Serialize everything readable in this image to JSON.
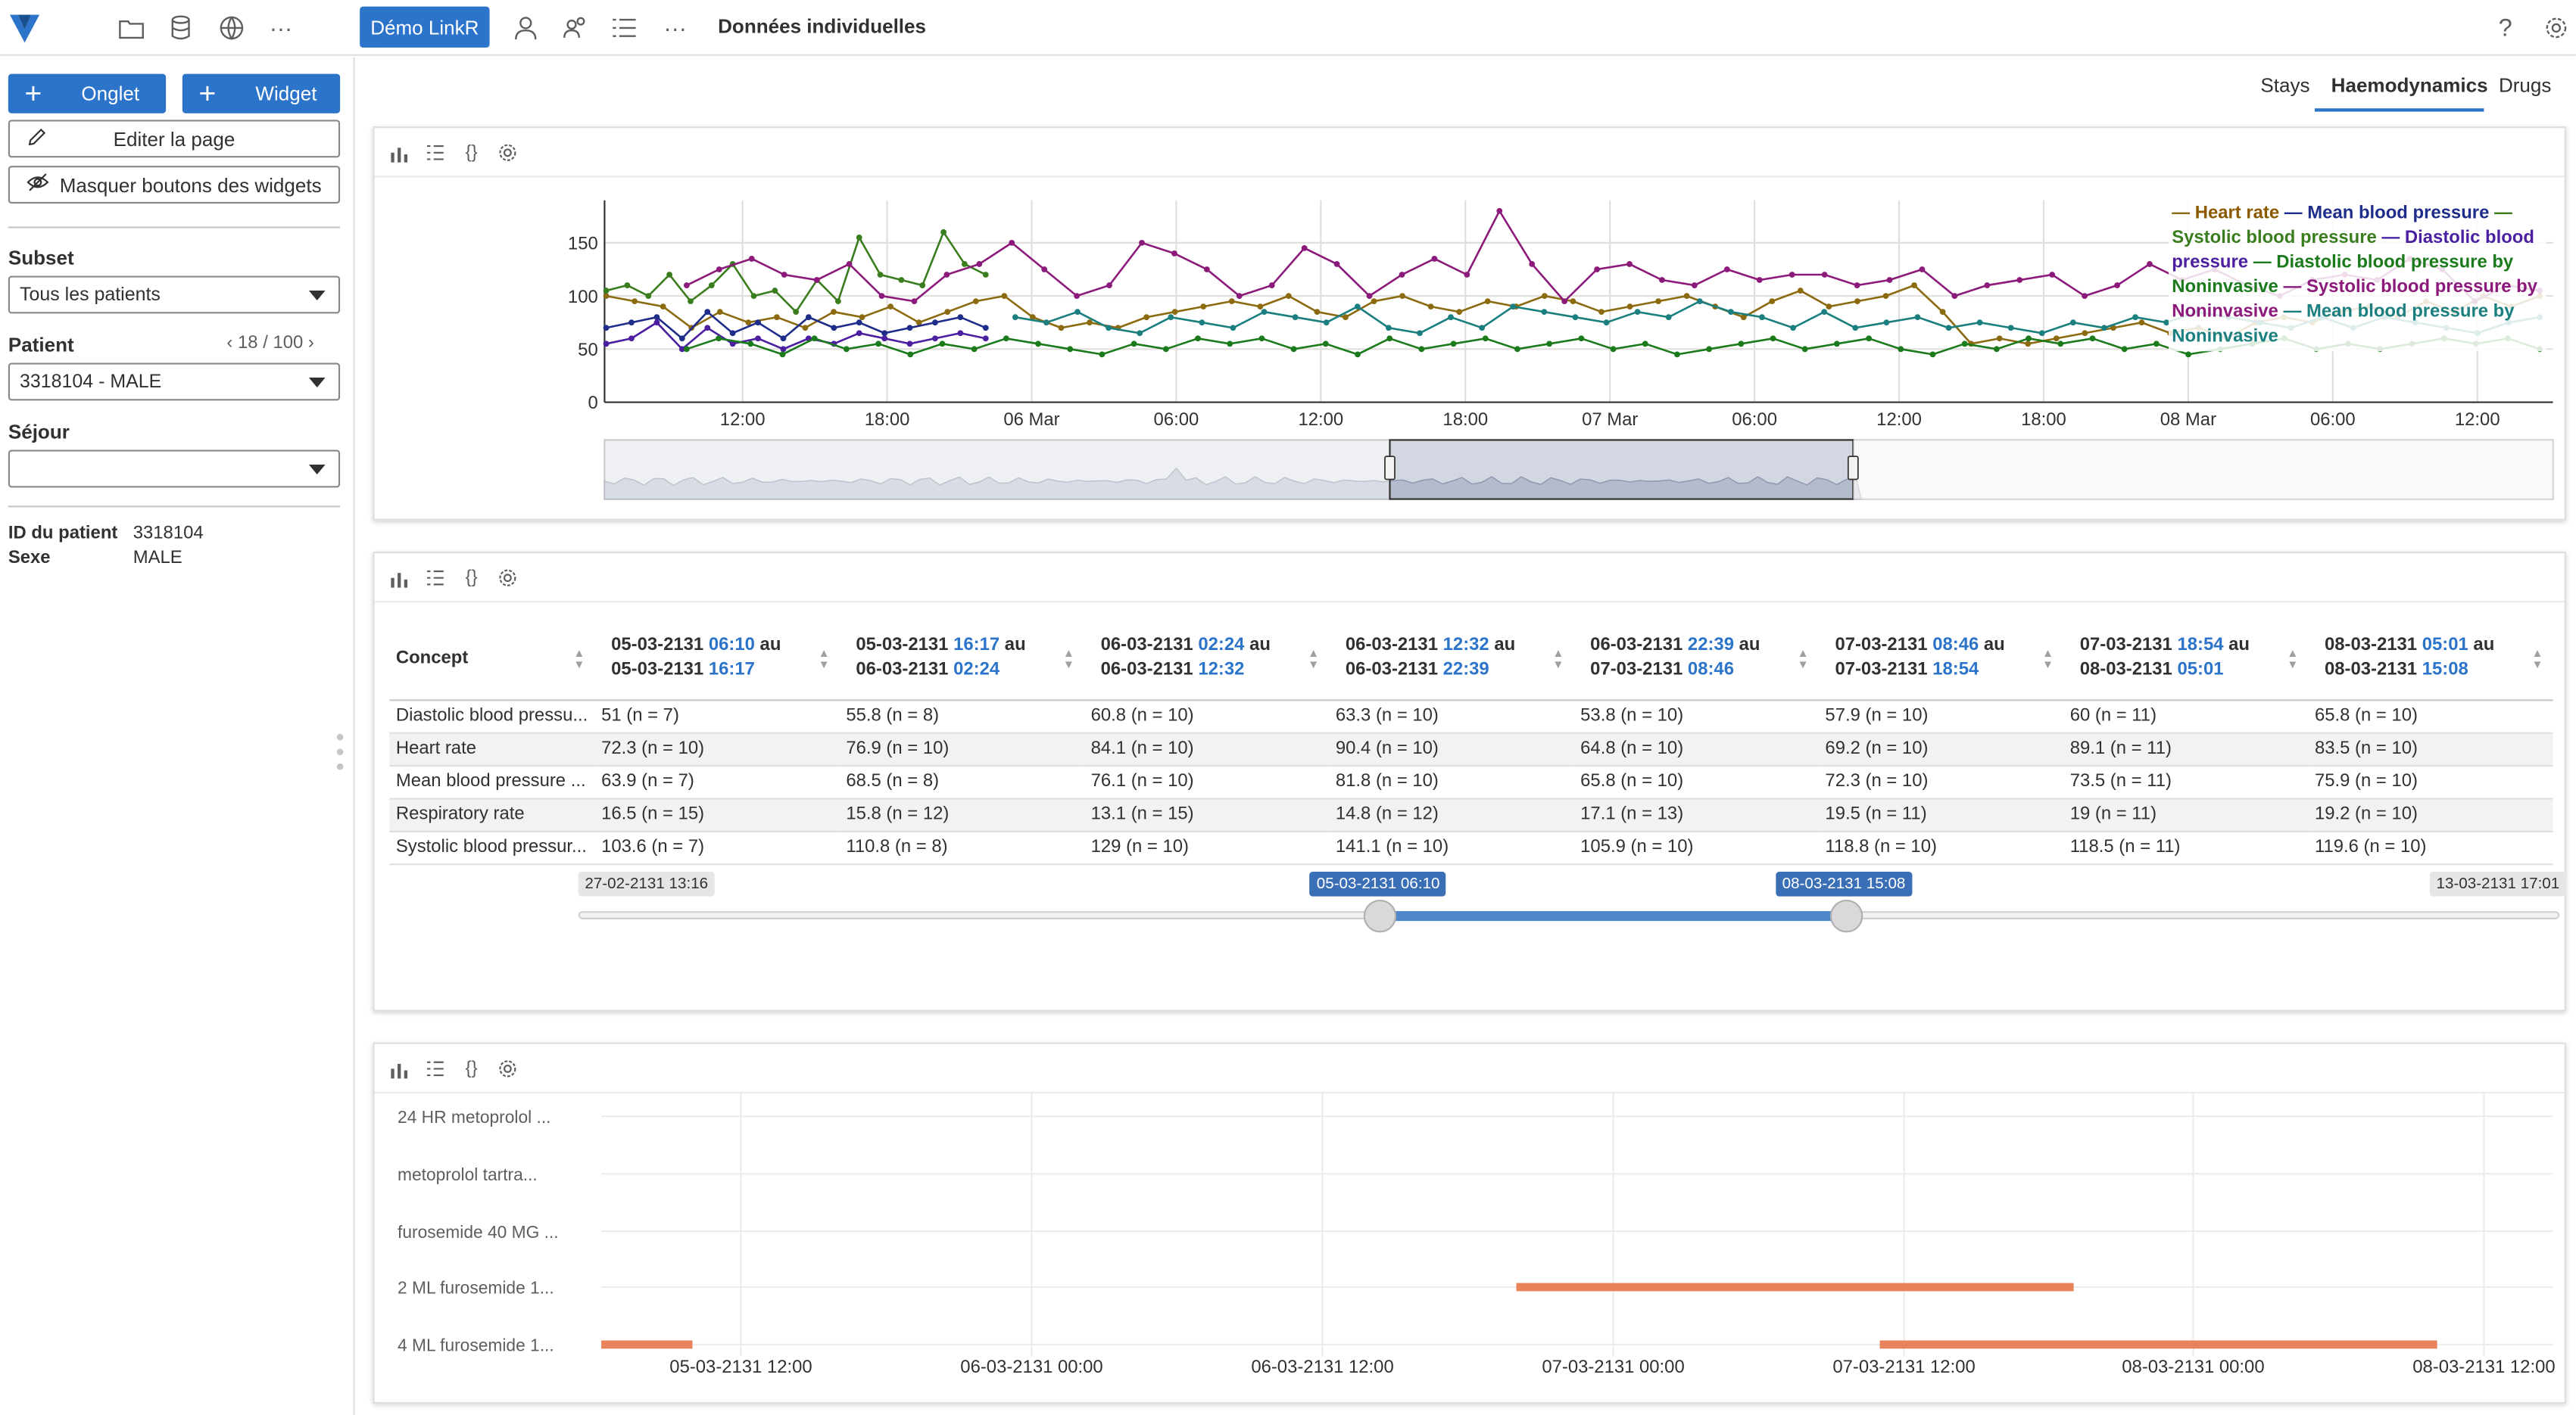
{
  "topbar": {
    "demo_button": "Démo LinkR",
    "more": "···",
    "page_title": "Données individuelles",
    "help": "?"
  },
  "sidebar": {
    "onglet_button": "Onglet",
    "widget_button": "Widget",
    "edit_page_button": "Editer la page",
    "hide_buttons": "Masquer boutons des widgets",
    "subset_label": "Subset",
    "subset_value": "Tous les patients",
    "patient_label": "Patient",
    "patient_pager": "18 / 100",
    "patient_value": "3318104 - MALE",
    "sejour_label": "Séjour",
    "sejour_value": "",
    "id_label": "ID du patient",
    "id_value": "3318104",
    "sex_label": "Sexe",
    "sex_value": "MALE"
  },
  "tabs": [
    "Stays",
    "Haemodynamics",
    "Drugs"
  ],
  "active_tab": "Haemodynamics",
  "chart_data": [
    {
      "type": "line",
      "y_ticks": [
        "0",
        "50",
        "100",
        "150"
      ],
      "ylim": [
        0,
        190
      ],
      "x_ticks": [
        "12:00",
        "18:00",
        "06 Mar",
        "06:00",
        "12:00",
        "18:00",
        "07 Mar",
        "06:00",
        "12:00",
        "18:00",
        "08 Mar",
        "06:00",
        "12:00"
      ],
      "legend_placement": "top-right",
      "legend_text": [
        {
          "text": "Heart rate",
          "color": "#8b5a00"
        },
        {
          "text": " — ",
          "color": "#1f2d8a"
        },
        {
          "text": "Mean blood pressure",
          "color": "#1f2d8a"
        },
        {
          "text": " — ",
          "color": "#3a7d1e"
        },
        {
          "text": "Systolic blood pressure",
          "color": "#3a7d1e"
        },
        {
          "text": " — ",
          "color": "#4b1fa0"
        },
        {
          "text": "Diastolic blood pressure",
          "color": "#4b1fa0"
        },
        {
          "text": " — ",
          "color": "#1b7a1b"
        },
        {
          "text": "Diastolic blood pressure by Noninvasive",
          "color": "#1b7a1b"
        },
        {
          "text": " — ",
          "color": "#8b1a7a"
        },
        {
          "text": "Systolic blood pressure by Noninvasive",
          "color": "#8b1a7a"
        },
        {
          "text": " — ",
          "color": "#1b7f7f"
        },
        {
          "text": "Mean blood pressure by Noninvasive",
          "color": "#1b7f7f"
        }
      ],
      "series": [
        {
          "name": "Heart rate",
          "color": "#8b6a10",
          "values": [
            100,
            95,
            90,
            70,
            85,
            75,
            80,
            70,
            85,
            80,
            90,
            75,
            85,
            95,
            100,
            80,
            70,
            75,
            70,
            80,
            85,
            90,
            95,
            90,
            100,
            85,
            80,
            95,
            100,
            90,
            85,
            95,
            90,
            100,
            95,
            85,
            90,
            95,
            100,
            90,
            80,
            95,
            105,
            90,
            95,
            100,
            110,
            85,
            55,
            60,
            55,
            60,
            65,
            70,
            75,
            65,
            70,
            60,
            75,
            80,
            75,
            85,
            90,
            80,
            95,
            85,
            100,
            90,
            100
          ]
        },
        {
          "name": "Mean blood pressure",
          "color": "#1f2d8a",
          "values": [
            70,
            75,
            80,
            60,
            85,
            65,
            75,
            60,
            80,
            70,
            75,
            65,
            70,
            75,
            80,
            70
          ]
        },
        {
          "name": "Systolic blood pressure",
          "color": "#3a7d1e",
          "values": [
            105,
            110,
            100,
            120,
            95,
            110,
            130,
            100,
            105,
            85,
            115,
            95,
            155,
            120,
            115,
            110,
            160,
            130,
            120
          ]
        },
        {
          "name": "Diastolic blood pressure",
          "color": "#4b1fa0",
          "values": [
            55,
            60,
            75,
            50,
            70,
            55,
            60,
            50,
            60,
            55,
            65,
            60,
            55,
            60,
            65,
            60
          ]
        },
        {
          "name": "Diastolic blood pressure by Noninvasive",
          "color": "#1b7a1b",
          "values": [
            50,
            60,
            55,
            45,
            60,
            50,
            55,
            45,
            55,
            50,
            60,
            55,
            50,
            45,
            55,
            50,
            60,
            55,
            60,
            50,
            55,
            45,
            60,
            50,
            55,
            60,
            50,
            55,
            60,
            50,
            55,
            45,
            50,
            55,
            60,
            50,
            55,
            60,
            50,
            45,
            55,
            50,
            60,
            55,
            60,
            50,
            55,
            45,
            50,
            55,
            60,
            50,
            55,
            50,
            55,
            60,
            55,
            60,
            50
          ]
        },
        {
          "name": "Systolic blood pressure by Noninvasive",
          "color": "#8b1a7a",
          "values": [
            110,
            125,
            135,
            120,
            115,
            130,
            100,
            95,
            120,
            130,
            150,
            125,
            100,
            110,
            150,
            140,
            125,
            100,
            110,
            145,
            130,
            100,
            120,
            135,
            120,
            180,
            130,
            95,
            125,
            130,
            115,
            110,
            125,
            115,
            120,
            120,
            110,
            115,
            125,
            100,
            110,
            115,
            120,
            100,
            110,
            130,
            115,
            125,
            110,
            100,
            115,
            120,
            115,
            135,
            125,
            95,
            110,
            105
          ]
        },
        {
          "name": "Mean blood pressure by Noninvasive",
          "color": "#1b7f7f",
          "values": [
            80,
            75,
            85,
            70,
            65,
            80,
            75,
            70,
            85,
            80,
            75,
            90,
            70,
            65,
            80,
            70,
            90,
            85,
            80,
            75,
            85,
            80,
            95,
            85,
            80,
            70,
            85,
            70,
            75,
            80,
            70,
            75,
            70,
            65,
            75,
            70,
            80,
            75,
            85,
            80,
            75,
            70,
            80,
            70,
            80,
            75,
            70,
            65,
            75,
            80
          ]
        }
      ],
      "navigator_x_labels": []
    },
    {
      "type": "bar",
      "orientation": "horizontal",
      "categories": [
        "24 HR metoprolol ...",
        "metoprolol tartra...",
        "furosemide 40 MG ...",
        "2 ML furosemide 1...",
        "4 ML furosemide 1..."
      ],
      "x_ticks": [
        "05-03-2131 12:00",
        "06-03-2131 00:00",
        "06-03-2131 12:00",
        "07-03-2131 00:00",
        "07-03-2131 12:00",
        "08-03-2131 00:00",
        "08-03-2131 12:00"
      ],
      "x_range": [
        "05-03-2131 06:10",
        "08-03-2131 15:08"
      ],
      "bar_color": "#e8825a",
      "bars": [
        {
          "category": "2 ML furosemide 1...",
          "start": "06-03-2131 20:00",
          "end": "07-03-2131 19:00"
        },
        {
          "category": "4 ML furosemide 1...",
          "start": "05-03-2131 06:10",
          "end": "05-03-2131 10:00"
        },
        {
          "category": "4 ML furosemide 1...",
          "start": "07-03-2131 11:00",
          "end": "08-03-2131 10:00"
        }
      ]
    }
  ],
  "datatable": {
    "concept_header": "Concept",
    "columns": [
      {
        "d1": "05-03-2131",
        "t1": "06:10",
        "d2": "05-03-2131",
        "t2": "16:17"
      },
      {
        "d1": "05-03-2131",
        "t1": "16:17",
        "d2": "06-03-2131",
        "t2": "02:24"
      },
      {
        "d1": "06-03-2131",
        "t1": "02:24",
        "d2": "06-03-2131",
        "t2": "12:32"
      },
      {
        "d1": "06-03-2131",
        "t1": "12:32",
        "d2": "06-03-2131",
        "t2": "22:39"
      },
      {
        "d1": "06-03-2131",
        "t1": "22:39",
        "d2": "07-03-2131",
        "t2": "08:46"
      },
      {
        "d1": "07-03-2131",
        "t1": "08:46",
        "d2": "07-03-2131",
        "t2": "18:54"
      },
      {
        "d1": "07-03-2131",
        "t1": "18:54",
        "d2": "08-03-2131",
        "t2": "05:01"
      },
      {
        "d1": "08-03-2131",
        "t1": "05:01",
        "d2": "08-03-2131",
        "t2": "15:08"
      }
    ],
    "au": "au",
    "rows": [
      {
        "concept": "Diastolic blood pressu...",
        "values": [
          "51 (n = 7)",
          "55.8 (n = 8)",
          "60.8 (n = 10)",
          "63.3 (n = 10)",
          "53.8 (n = 10)",
          "57.9 (n = 10)",
          "60 (n = 11)",
          "65.8 (n = 10)"
        ]
      },
      {
        "concept": "Heart rate",
        "values": [
          "72.3 (n = 10)",
          "76.9 (n = 10)",
          "84.1 (n = 10)",
          "90.4 (n = 10)",
          "64.8 (n = 10)",
          "69.2 (n = 10)",
          "89.1 (n = 11)",
          "83.5 (n = 10)"
        ]
      },
      {
        "concept": "Mean blood pressure ...",
        "values": [
          "63.9 (n = 7)",
          "68.5 (n = 8)",
          "76.1 (n = 10)",
          "81.8 (n = 10)",
          "65.8 (n = 10)",
          "72.3 (n = 10)",
          "73.5 (n = 11)",
          "75.9 (n = 10)"
        ]
      },
      {
        "concept": "Respiratory rate",
        "values": [
          "16.5 (n = 15)",
          "15.8 (n = 12)",
          "13.1 (n = 15)",
          "14.8 (n = 12)",
          "17.1 (n = 13)",
          "19.5 (n = 11)",
          "19 (n = 11)",
          "19.2 (n = 10)"
        ]
      },
      {
        "concept": "Systolic blood pressur...",
        "values": [
          "103.6 (n = 7)",
          "110.8 (n = 8)",
          "129 (n = 10)",
          "141.1 (n = 10)",
          "105.9 (n = 10)",
          "118.8 (n = 10)",
          "118.5 (n = 11)",
          "119.6 (n = 10)"
        ]
      }
    ],
    "slider": {
      "min_label": "27-02-2131 13:16",
      "from_label": "05-03-2131 06:10",
      "to_label": "08-03-2131 15:08",
      "max_label": "13-03-2131 17:01",
      "from_fraction": 0.405,
      "to_fraction": 0.64
    }
  },
  "icons": {
    "bar_chart": "bar-chart-icon",
    "list": "list-icon",
    "code": "code-icon",
    "settings": "gear-icon"
  }
}
